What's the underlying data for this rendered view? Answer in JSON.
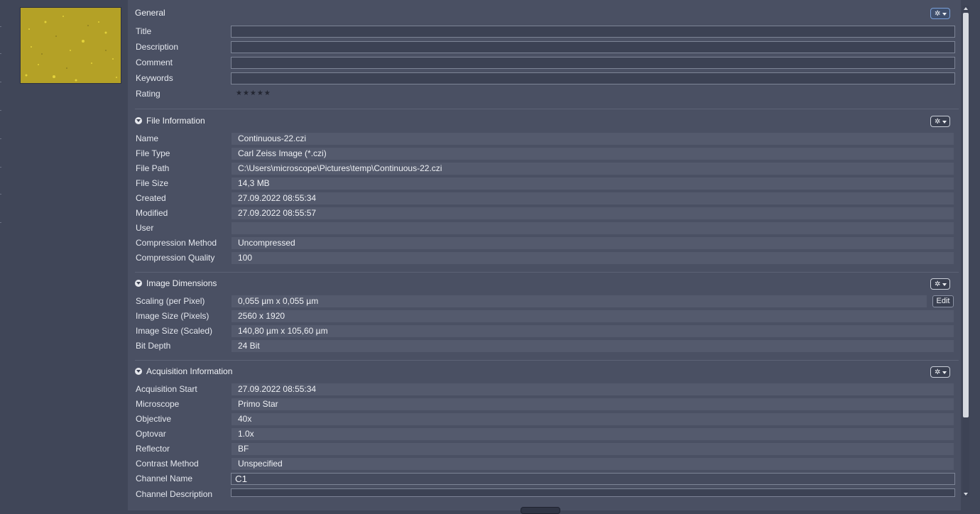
{
  "general": {
    "title": "General",
    "fields": [
      {
        "label": "Title",
        "value": ""
      },
      {
        "label": "Description",
        "value": ""
      },
      {
        "label": "Comment",
        "value": ""
      },
      {
        "label": "Keywords",
        "value": ""
      }
    ],
    "rating_label": "Rating",
    "rating_stars": "★★★★★"
  },
  "file_information": {
    "title": "File Information",
    "rows": [
      {
        "label": "Name",
        "value": "Continuous-22.czi"
      },
      {
        "label": "File Type",
        "value": "Carl Zeiss Image (*.czi)"
      },
      {
        "label": "File Path",
        "value": "C:\\Users\\microscope\\Pictures\\temp\\Continuous-22.czi"
      },
      {
        "label": "File Size",
        "value": "14,3 MB"
      },
      {
        "label": "Created",
        "value": "27.09.2022 08:55:34"
      },
      {
        "label": "Modified",
        "value": "27.09.2022 08:55:57"
      },
      {
        "label": "User",
        "value": ""
      },
      {
        "label": "Compression Method",
        "value": "Uncompressed"
      },
      {
        "label": "Compression Quality",
        "value": "100"
      }
    ]
  },
  "image_dimensions": {
    "title": "Image Dimensions",
    "edit_label": "Edit",
    "rows": [
      {
        "label": "Scaling (per Pixel)",
        "value": "0,055 µm x 0,055 µm"
      },
      {
        "label": "Image Size (Pixels)",
        "value": "2560 x 1920"
      },
      {
        "label": "Image Size (Scaled)",
        "value": "140,80 µm x 105,60 µm"
      },
      {
        "label": "Bit Depth",
        "value": "24 Bit"
      }
    ]
  },
  "acquisition_information": {
    "title": "Acquisition Information",
    "rows": [
      {
        "label": "Acquisition Start",
        "value": "27.09.2022 08:55:34"
      },
      {
        "label": "Microscope",
        "value": "Primo Star"
      },
      {
        "label": "Objective",
        "value": "40x"
      },
      {
        "label": "Optovar",
        "value": "1.0x"
      },
      {
        "label": "Reflector",
        "value": "BF"
      },
      {
        "label": "Contrast Method",
        "value": "Unspecified"
      }
    ],
    "channel_name_label": "Channel Name",
    "channel_name_value": "C1",
    "channel_description_label": "Channel Description",
    "channel_description_value": ""
  },
  "icons": {
    "gear": "gear-icon",
    "collapse": "collapse-circle-icon",
    "scroll_up": "arrow-up-icon",
    "scroll_down": "arrow-down-icon"
  },
  "colors": {
    "background": "#404658",
    "panel": "#4a5063",
    "value_field": "#545a6d",
    "thumbnail": "#b9a528"
  }
}
